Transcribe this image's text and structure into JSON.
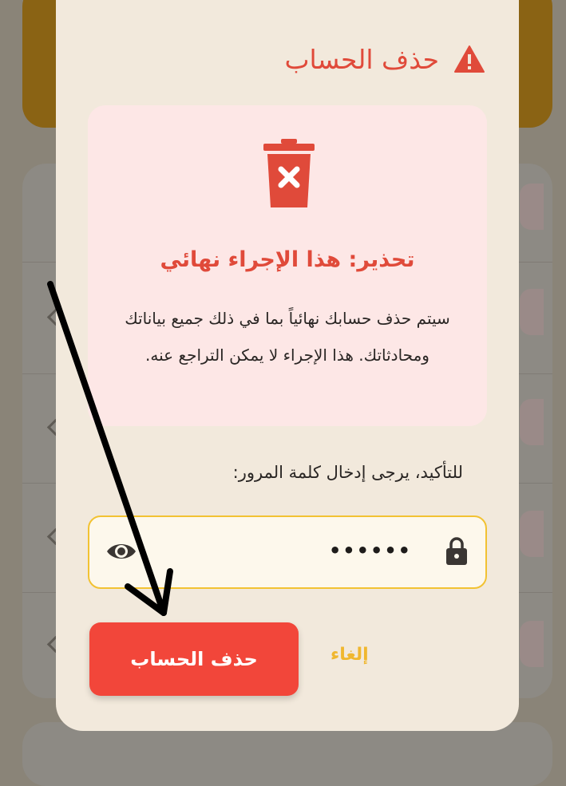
{
  "modal": {
    "title": "حذف الحساب",
    "title_icon": "warning-triangle-icon",
    "warning_box": {
      "icon": "trash-delete-icon",
      "heading": "تحذير: هذا الإجراء نهائي",
      "body": "سيتم حذف حسابك نهائياً بما في ذلك جميع بياناتك ومحادثاتك. هذا الإجراء لا يمكن التراجع عنه."
    },
    "confirm_label": "للتأكيد، يرجى إدخال كلمة المرور:",
    "password": {
      "value": "••••••",
      "show_icon": "eye-icon",
      "lock_icon": "lock-icon"
    },
    "delete_button": "حذف الحساب",
    "cancel_button": "إلغاء"
  },
  "colors": {
    "danger": "#f2463a",
    "danger_text": "#e04a3a",
    "accent": "#f2c232",
    "modal_bg": "#f2e9dc",
    "warning_bg": "#fde7e6"
  }
}
